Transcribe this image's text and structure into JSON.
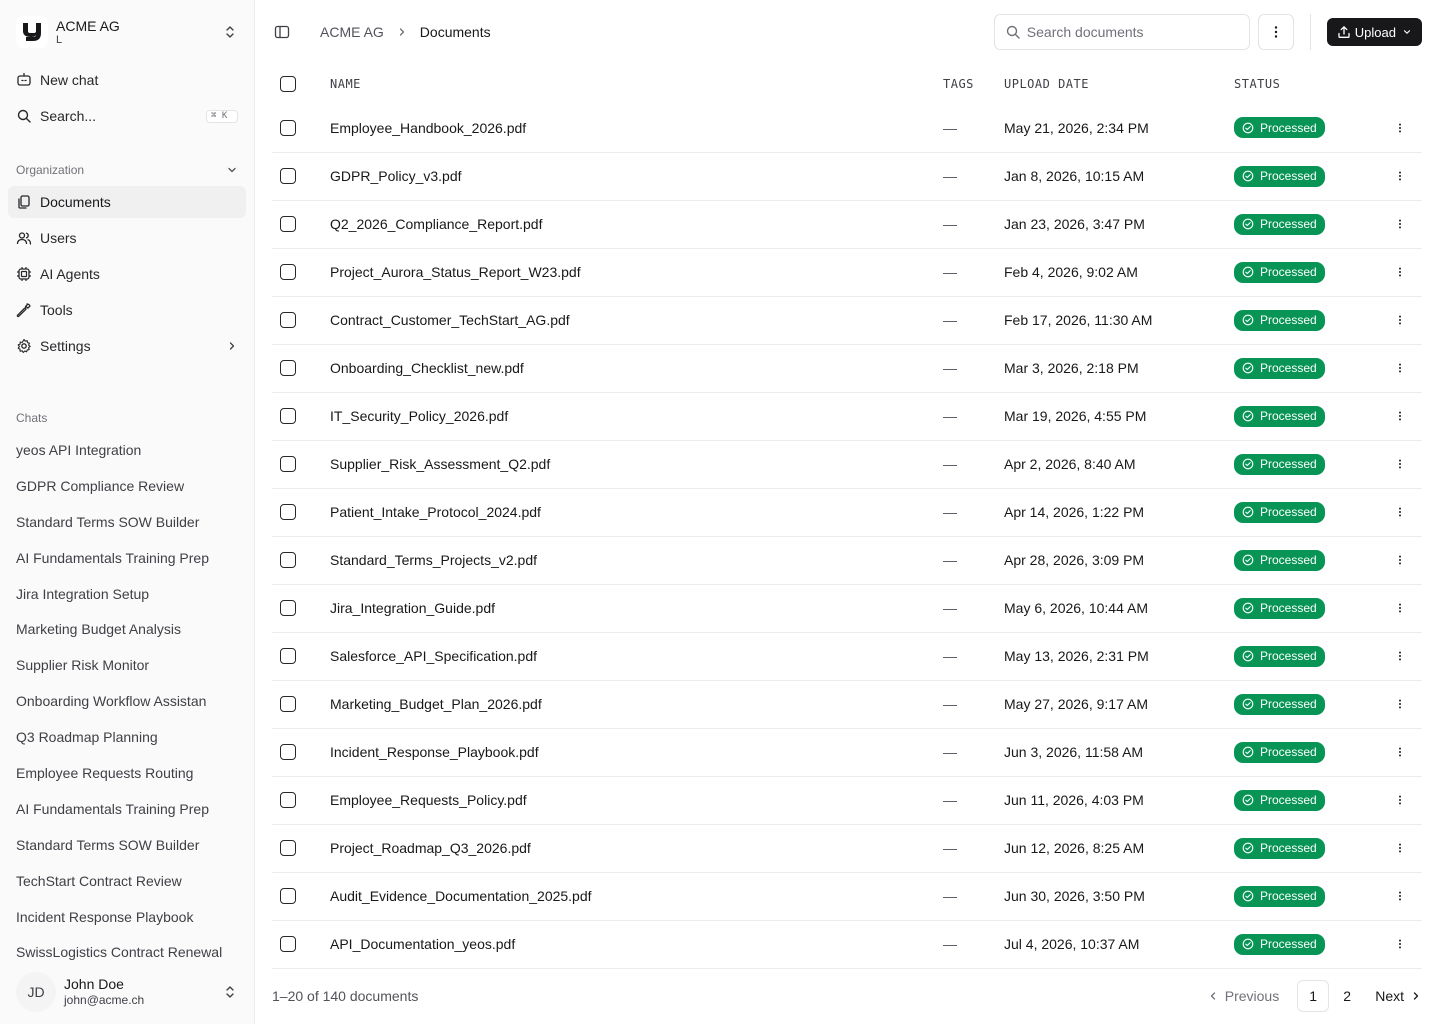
{
  "workspace": {
    "name": "ACME AG",
    "sub": "L"
  },
  "nav": {
    "new_chat": "New chat",
    "search": "Search...",
    "search_shortcut": "⌘ K"
  },
  "organization": {
    "label": "Organization",
    "items": [
      {
        "label": "Documents",
        "icon": "documents-icon",
        "active": true
      },
      {
        "label": "Users",
        "icon": "users-icon"
      },
      {
        "label": "AI Agents",
        "icon": "bot-icon"
      },
      {
        "label": "Tools",
        "icon": "wrench-icon"
      },
      {
        "label": "Settings",
        "icon": "gear-icon"
      }
    ]
  },
  "chats": {
    "label": "Chats",
    "items": [
      "yeos API Integration",
      "GDPR Compliance Review",
      "Standard Terms SOW Builder",
      "AI Fundamentals Training Prep",
      "Jira Integration Setup",
      "Marketing Budget Analysis",
      "Supplier Risk Monitor",
      "Onboarding Workflow Assistan",
      "Q3 Roadmap Planning",
      "Employee Requests Routing",
      "AI Fundamentals Training Prep",
      "Standard Terms SOW Builder",
      "TechStart Contract Review",
      "Incident Response Playbook",
      "SwissLogistics Contract Renewal"
    ]
  },
  "user": {
    "initials": "JD",
    "name": "John Doe",
    "email": "john@acme.ch"
  },
  "breadcrumb": {
    "root": "ACME AG",
    "current": "Documents"
  },
  "toolbar": {
    "search_placeholder": "Search documents",
    "upload_label": "Upload"
  },
  "table": {
    "headers": {
      "name": "NAME",
      "tags": "TAGS",
      "date": "UPLOAD DATE",
      "status": "STATUS"
    },
    "rows": [
      {
        "name": "Employee_Handbook_2026.pdf",
        "tags": "—",
        "date": "May 21, 2026, 2:34 PM",
        "status": "Processed"
      },
      {
        "name": "GDPR_Policy_v3.pdf",
        "tags": "—",
        "date": "Jan 8, 2026, 10:15 AM",
        "status": "Processed"
      },
      {
        "name": "Q2_2026_Compliance_Report.pdf",
        "tags": "—",
        "date": "Jan 23, 2026, 3:47 PM",
        "status": "Processed"
      },
      {
        "name": "Project_Aurora_Status_Report_W23.pdf",
        "tags": "—",
        "date": "Feb 4, 2026, 9:02 AM",
        "status": "Processed"
      },
      {
        "name": "Contract_Customer_TechStart_AG.pdf",
        "tags": "—",
        "date": "Feb 17, 2026, 11:30 AM",
        "status": "Processed"
      },
      {
        "name": "Onboarding_Checklist_new.pdf",
        "tags": "—",
        "date": "Mar 3, 2026, 2:18 PM",
        "status": "Processed"
      },
      {
        "name": "IT_Security_Policy_2026.pdf",
        "tags": "—",
        "date": "Mar 19, 2026, 4:55 PM",
        "status": "Processed"
      },
      {
        "name": "Supplier_Risk_Assessment_Q2.pdf",
        "tags": "—",
        "date": "Apr 2, 2026, 8:40 AM",
        "status": "Processed"
      },
      {
        "name": "Patient_Intake_Protocol_2024.pdf",
        "tags": "—",
        "date": "Apr 14, 2026, 1:22 PM",
        "status": "Processed"
      },
      {
        "name": "Standard_Terms_Projects_v2.pdf",
        "tags": "—",
        "date": "Apr 28, 2026, 3:09 PM",
        "status": "Processed"
      },
      {
        "name": "Jira_Integration_Guide.pdf",
        "tags": "—",
        "date": "May 6, 2026, 10:44 AM",
        "status": "Processed"
      },
      {
        "name": "Salesforce_API_Specification.pdf",
        "tags": "—",
        "date": "May 13, 2026, 2:31 PM",
        "status": "Processed"
      },
      {
        "name": "Marketing_Budget_Plan_2026.pdf",
        "tags": "—",
        "date": "May 27, 2026, 9:17 AM",
        "status": "Processed"
      },
      {
        "name": "Incident_Response_Playbook.pdf",
        "tags": "—",
        "date": "Jun 3, 2026, 11:58 AM",
        "status": "Processed"
      },
      {
        "name": "Employee_Requests_Policy.pdf",
        "tags": "—",
        "date": "Jun 11, 2026, 4:03 PM",
        "status": "Processed"
      },
      {
        "name": "Project_Roadmap_Q3_2026.pdf",
        "tags": "—",
        "date": "Jun 12, 2026, 8:25 AM",
        "status": "Processed"
      },
      {
        "name": "Audit_Evidence_Documentation_2025.pdf",
        "tags": "—",
        "date": "Jun 30, 2026, 3:50 PM",
        "status": "Processed"
      },
      {
        "name": "API_Documentation_yeos.pdf",
        "tags": "—",
        "date": "Jul 4, 2026, 10:37 AM",
        "status": "Processed"
      }
    ]
  },
  "footer": {
    "count_text": "1–20 of 140 documents",
    "previous": "Previous",
    "pages": [
      "1",
      "2"
    ],
    "current_page": "1",
    "next": "Next"
  },
  "colors": {
    "status_processed": "#079455",
    "primary_button": "#18181b",
    "sidebar_bg": "#fafafa"
  }
}
